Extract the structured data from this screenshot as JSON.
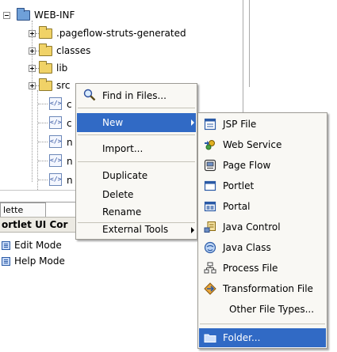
{
  "tree": {
    "root_label": "WEB-INF",
    "children": [
      ".pageflow-struts-generated",
      "classes",
      "lib",
      "src"
    ],
    "files": [
      "c",
      "c",
      "n",
      "n",
      "n"
    ]
  },
  "palette": {
    "tab_label": "lette",
    "header": "ortlet UI Cor",
    "items": [
      "Edit Mode",
      "Help Mode"
    ]
  },
  "context_menu": {
    "items": [
      {
        "label": "Find in Files..."
      },
      {
        "label": "New",
        "has_submenu": true,
        "highlighted": true
      },
      {
        "label": "Import..."
      },
      {
        "label": "Duplicate"
      },
      {
        "label": "Delete"
      },
      {
        "label": "Rename"
      },
      {
        "label": "External Tools",
        "has_submenu": true
      }
    ]
  },
  "new_submenu": {
    "items": [
      {
        "label": "JSP File",
        "icon": "jsp-file-icon"
      },
      {
        "label": "Web Service",
        "icon": "web-service-icon"
      },
      {
        "label": "Page Flow",
        "icon": "page-flow-icon"
      },
      {
        "label": "Portlet",
        "icon": "portlet-icon"
      },
      {
        "label": "Portal",
        "icon": "portal-icon"
      },
      {
        "label": "Java Control",
        "icon": "java-control-icon"
      },
      {
        "label": "Java Class",
        "icon": "java-class-icon"
      },
      {
        "label": "Process File",
        "icon": "process-file-icon"
      },
      {
        "label": "Transformation File",
        "icon": "transformation-file-icon"
      },
      {
        "label": "Other File Types...",
        "icon": ""
      },
      {
        "label": "Folder...",
        "icon": "folder-icon",
        "highlighted": true
      }
    ]
  },
  "colors": {
    "menu_highlight": "#316ac5",
    "menu_background": "#f9f8f4",
    "folder_yellow": "#f0d267"
  }
}
